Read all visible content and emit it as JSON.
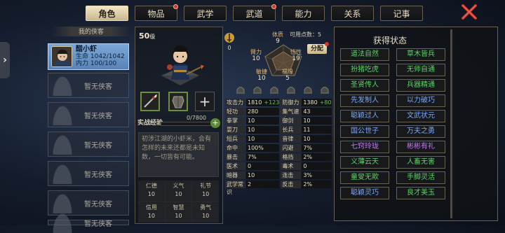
{
  "tabs": [
    {
      "label": "角色",
      "active": true,
      "badge": false
    },
    {
      "label": "物品",
      "active": false,
      "badge": true
    },
    {
      "label": "武学",
      "active": false,
      "badge": false
    },
    {
      "label": "武道",
      "active": false,
      "badge": true
    },
    {
      "label": "能力",
      "active": false,
      "badge": false
    },
    {
      "label": "关系",
      "active": false,
      "badge": false
    },
    {
      "label": "记事",
      "active": false,
      "badge": false
    }
  ],
  "left": {
    "header": "我的侠客",
    "character": {
      "name": "醋小虾",
      "hp": "生命 1042/1042",
      "mp": "内力 100/100"
    },
    "empty_label": "暂无侠客",
    "empty_count": 6
  },
  "profile": {
    "level": "50",
    "level_unit": "级",
    "exp_label": "实战经验",
    "exp_value": "0/7800",
    "description": "初涉江湖的小虾米，会有怎样的未来还都是未知数，一切皆有可能。",
    "virtues": [
      {
        "label": "仁德",
        "value": "10"
      },
      {
        "label": "义气",
        "value": "10"
      },
      {
        "label": "礼节",
        "value": "10"
      },
      {
        "label": "信用",
        "value": "10"
      },
      {
        "label": "智慧",
        "value": "10"
      },
      {
        "label": "勇气",
        "value": "10"
      }
    ]
  },
  "attributes": {
    "buff_value": "0",
    "available_points": "可用点数：5",
    "assign_label": "分配",
    "items": [
      {
        "name": "体质",
        "value": "9"
      },
      {
        "name": "悟性",
        "value": "19"
      },
      {
        "name": "福缘",
        "value": "5"
      },
      {
        "name": "敏捷",
        "value": "10"
      },
      {
        "name": "臂力",
        "value": "10"
      }
    ]
  },
  "stats": [
    {
      "label": "攻击力",
      "value": "1810",
      "bonus": "+123"
    },
    {
      "label": "防御力",
      "value": "1380",
      "bonus": "+80"
    },
    {
      "label": "轻功",
      "value": "280"
    },
    {
      "label": "集气速度",
      "value": "43"
    },
    {
      "label": "拳掌",
      "value": "10"
    },
    {
      "label": "御剑",
      "value": "10"
    },
    {
      "label": "耍刀",
      "value": "10"
    },
    {
      "label": "长兵",
      "value": "11"
    },
    {
      "label": "短兵",
      "value": "10"
    },
    {
      "label": "音律",
      "value": "10"
    },
    {
      "label": "命中",
      "value": "100%"
    },
    {
      "label": "闪避",
      "value": "7%"
    },
    {
      "label": "暴击",
      "value": "7%"
    },
    {
      "label": "格挡",
      "value": "2%"
    },
    {
      "label": "医术",
      "value": "0"
    },
    {
      "label": "毒术",
      "value": "0"
    },
    {
      "label": "暗器",
      "value": "10"
    },
    {
      "label": "连击",
      "value": "3%"
    },
    {
      "label": "武学常识",
      "value": "2"
    },
    {
      "label": "反击",
      "value": "2%"
    }
  ],
  "status": {
    "title": "获得状态",
    "buttons": [
      {
        "label": "道法自然",
        "color": "#5fd06a"
      },
      {
        "label": "草木皆兵",
        "color": "#5fd06a"
      },
      {
        "label": "扮猪吃虎",
        "color": "#5fd06a"
      },
      {
        "label": "无师自通",
        "color": "#5fd06a"
      },
      {
        "label": "圣贤传人",
        "color": "#5fd06a"
      },
      {
        "label": "兵器精通",
        "color": "#5fd06a"
      },
      {
        "label": "先发制人",
        "color": "#7aa8ff"
      },
      {
        "label": "以力破巧",
        "color": "#7aa8ff"
      },
      {
        "label": "聪颖过人",
        "color": "#7aa8ff"
      },
      {
        "label": "文武状元",
        "color": "#7aa8ff"
      },
      {
        "label": "国公世子",
        "color": "#7aa8ff"
      },
      {
        "label": "万夫之勇",
        "color": "#7aa8ff"
      },
      {
        "label": "七窍玲珑",
        "color": "#c27cf0"
      },
      {
        "label": "彬彬有礼",
        "color": "#c27cf0"
      },
      {
        "label": "义薄云天",
        "color": "#5fd06a"
      },
      {
        "label": "人畜无害",
        "color": "#5fd06a"
      },
      {
        "label": "童叟无欺",
        "color": "#5fd06a"
      },
      {
        "label": "手脚灵活",
        "color": "#5fd06a"
      },
      {
        "label": "聪颖灵巧",
        "color": "#7aa8ff"
      },
      {
        "label": "良才美玉",
        "color": "#5fd06a"
      }
    ]
  }
}
